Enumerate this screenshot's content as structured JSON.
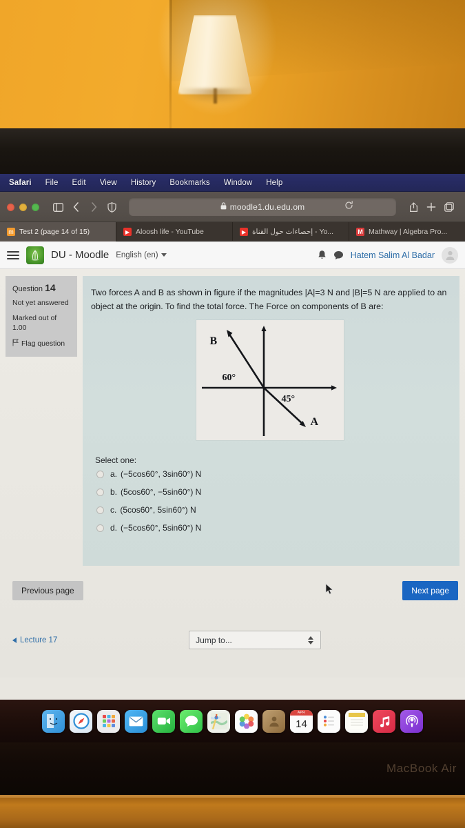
{
  "photo": {
    "device_label": "MacBook Air"
  },
  "menubar": {
    "items": [
      {
        "label": "Safari",
        "bold": true
      },
      {
        "label": "File",
        "bold": false
      },
      {
        "label": "Edit",
        "bold": false
      },
      {
        "label": "View",
        "bold": false
      },
      {
        "label": "History",
        "bold": false
      },
      {
        "label": "Bookmarks",
        "bold": false
      },
      {
        "label": "Window",
        "bold": false
      },
      {
        "label": "Help",
        "bold": false
      }
    ]
  },
  "toolbar": {
    "url": "moodle1.du.edu.om",
    "lock_icon": "lock-icon",
    "reload_icon": "reload-icon",
    "sidebar_icon": "sidebar-icon",
    "back_icon": "back-chevron-icon",
    "forward_icon": "forward-chevron-icon",
    "shield_icon": "privacy-shield-icon",
    "share_icon": "share-icon",
    "newtab_icon": "plus-icon",
    "tabs_icon": "tab-overview-icon"
  },
  "tabs": [
    {
      "title": "Test 2 (page 14 of 15)",
      "favicon": "moodle-icon",
      "active": true
    },
    {
      "title": "Aloosh life - YouTube",
      "favicon": "youtube-icon",
      "active": false
    },
    {
      "title": "إحصاءات حول القناة - Yo...",
      "favicon": "youtube-icon",
      "active": false
    },
    {
      "title": "Mathway | Algebra Pro...",
      "favicon": "mathway-icon",
      "active": false
    }
  ],
  "moodle_nav": {
    "menu_icon": "hamburger-menu-icon",
    "logo_alt": "dhofar-university-logo",
    "brand": "DU - Moodle",
    "language": "English (en)",
    "bell_icon": "notifications-bell-icon",
    "chat_icon": "messages-bubble-icon",
    "username": "Hatem Salim Al Badar",
    "avatar_alt": "user-avatar"
  },
  "question": {
    "number_label": "Question",
    "number": "14",
    "status": "Not yet answered",
    "marked_label": "Marked out of",
    "marks": "1.00",
    "flag_label": "Flag question",
    "text": "Two forces A and B as shown in figure if the magnitudes |A|=3 N and |B|=5 N are applied to an object at the origin. To find the total force. The Force on components of B are:",
    "figure": {
      "vector_b_label": "B",
      "vector_a_label": "A",
      "angle_b": "60°",
      "angle_a": "45°"
    },
    "select_prompt": "Select one:",
    "options": [
      {
        "key": "a.",
        "text": "(−5cos60°, 3sin60°) N",
        "selected": false
      },
      {
        "key": "b.",
        "text": "(5cos60°, −5sin60°) N",
        "selected": false
      },
      {
        "key": "c.",
        "text": "(5cos60°, 5sin60°) N",
        "selected": false
      },
      {
        "key": "d.",
        "text": "(−5cos60°, 5sin60°) N",
        "selected": false
      }
    ]
  },
  "navigation": {
    "previous_page": "Previous page",
    "next_page": "Next page",
    "lecture_link": "Lecture 17",
    "jump_placeholder": "Jump to..."
  },
  "dock": {
    "apps": [
      {
        "name": "finder",
        "glyph": "",
        "bg": "#3f9ae0",
        "running": true
      },
      {
        "name": "safari",
        "glyph": "",
        "bg": "#f2f4f7",
        "running": true
      },
      {
        "name": "launchpad",
        "glyph": "",
        "bg": "#e9e9ec",
        "running": false
      },
      {
        "name": "mail",
        "glyph": "✉",
        "bg": "#3aa7ef",
        "running": false
      },
      {
        "name": "facetime",
        "glyph": "",
        "bg": "#3fc259",
        "running": false
      },
      {
        "name": "messages",
        "glyph": "",
        "bg": "#4fd05d",
        "running": false
      },
      {
        "name": "maps",
        "glyph": "",
        "bg": "#eef0ea",
        "running": false
      },
      {
        "name": "photos",
        "glyph": "",
        "bg": "#fbfbfb",
        "running": false
      },
      {
        "name": "contacts",
        "glyph": "",
        "bg": "#a78152",
        "running": false
      },
      {
        "name": "calendar",
        "glyph": "",
        "bg": "#ffffff",
        "running": false
      },
      {
        "name": "reminders",
        "glyph": "",
        "bg": "#fbfbfb",
        "running": false
      },
      {
        "name": "notes",
        "glyph": "",
        "bg": "#f7f2df",
        "running": false
      },
      {
        "name": "music",
        "glyph": "♫",
        "bg": "#e8374a",
        "running": false
      },
      {
        "name": "podcasts",
        "glyph": "",
        "bg": "#8c3fd6",
        "running": false
      }
    ],
    "calendar_month": "APR",
    "calendar_day": "14"
  }
}
